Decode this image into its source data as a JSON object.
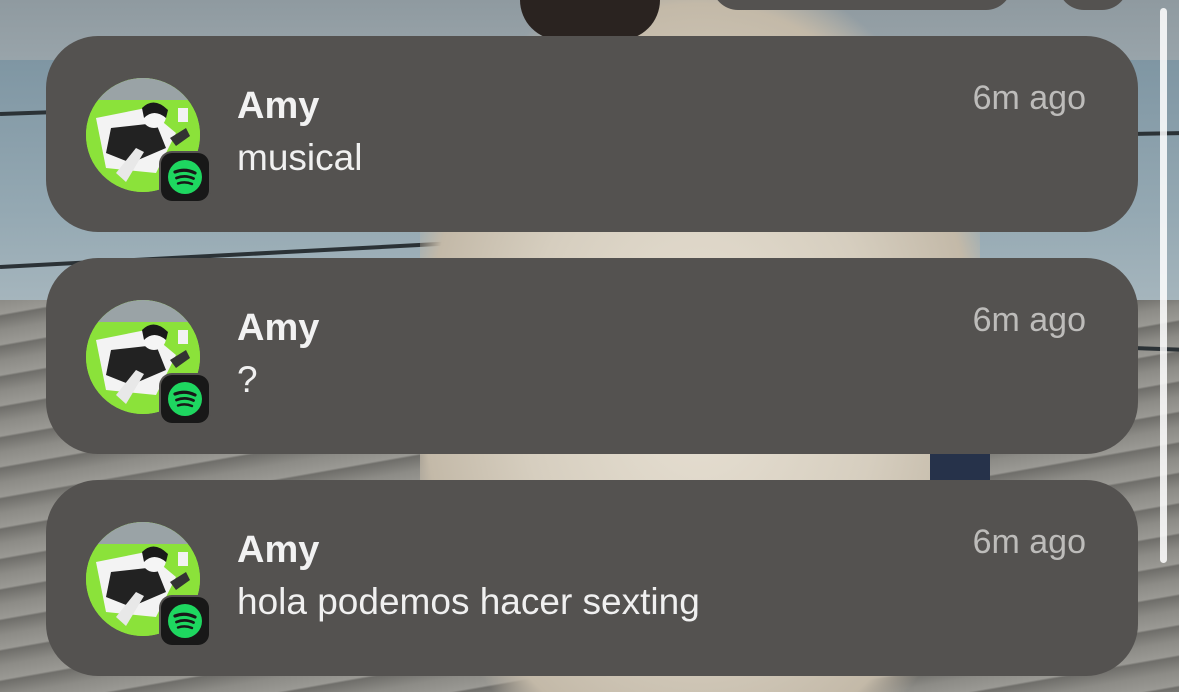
{
  "notifications": [
    {
      "sender": "Amy",
      "message": "musical",
      "time": "6m ago",
      "app_icon": "spotify-icon",
      "avatar_icon": "anime-avatar"
    },
    {
      "sender": "Amy",
      "message": "?",
      "time": "6m ago",
      "app_icon": "spotify-icon",
      "avatar_icon": "anime-avatar"
    },
    {
      "sender": "Amy",
      "message": "hola podemos hacer sexting",
      "time": "6m ago",
      "app_icon": "spotify-icon",
      "avatar_icon": "anime-avatar"
    }
  ],
  "colors": {
    "card_background": "#545250",
    "spotify_green": "#1ED760",
    "avatar_green": "#8BE23A",
    "time_text": "#BDBCBA",
    "primary_text": "#F2F2F2"
  }
}
